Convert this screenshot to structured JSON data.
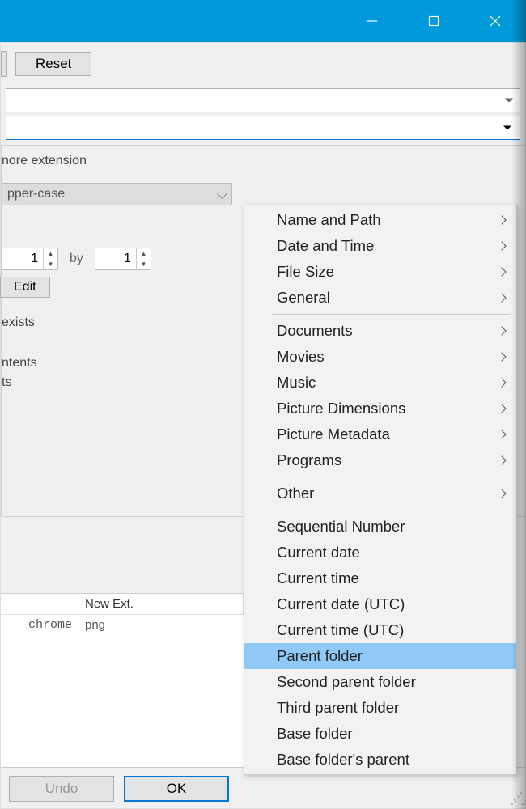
{
  "titlebar": {
    "minimize": "minimize",
    "maximize": "maximize",
    "close": "close"
  },
  "toolbar": {
    "reset_label": "Reset"
  },
  "form": {
    "ignore_ext_label": "nore extension",
    "case_select_value": "pper-case",
    "spinner1_value": "1",
    "by_label": "by",
    "spinner2_value": "1",
    "edit_label": "Edit",
    "exists_label": " exists",
    "contents_label": "ntents",
    "ts_label": "ts"
  },
  "table": {
    "header2": "New Ext.",
    "row1_name": "_chrome",
    "row1_ext": "png"
  },
  "buttons": {
    "undo": "Undo",
    "ok": "OK"
  },
  "menu": {
    "groups": [
      {
        "label": "Name and Path",
        "submenu": true
      },
      {
        "label": "Date and Time",
        "submenu": true
      },
      {
        "label": "File Size",
        "submenu": true
      },
      {
        "label": "General",
        "submenu": true
      }
    ],
    "groups2": [
      {
        "label": "Documents",
        "submenu": true
      },
      {
        "label": "Movies",
        "submenu": true
      },
      {
        "label": "Music",
        "submenu": true
      },
      {
        "label": "Picture Dimensions",
        "submenu": true
      },
      {
        "label": "Picture Metadata",
        "submenu": true
      },
      {
        "label": "Programs",
        "submenu": true
      }
    ],
    "other": {
      "label": "Other",
      "submenu": true
    },
    "items": [
      {
        "label": "Sequential Number",
        "highlight": false
      },
      {
        "label": "Current date",
        "highlight": false
      },
      {
        "label": "Current time",
        "highlight": false
      },
      {
        "label": "Current date (UTC)",
        "highlight": false
      },
      {
        "label": "Current time (UTC)",
        "highlight": false
      },
      {
        "label": "Parent folder",
        "highlight": true
      },
      {
        "label": "Second parent folder",
        "highlight": false
      },
      {
        "label": "Third parent folder",
        "highlight": false
      },
      {
        "label": "Base folder",
        "highlight": false
      },
      {
        "label": "Base folder's parent",
        "highlight": false
      }
    ]
  }
}
